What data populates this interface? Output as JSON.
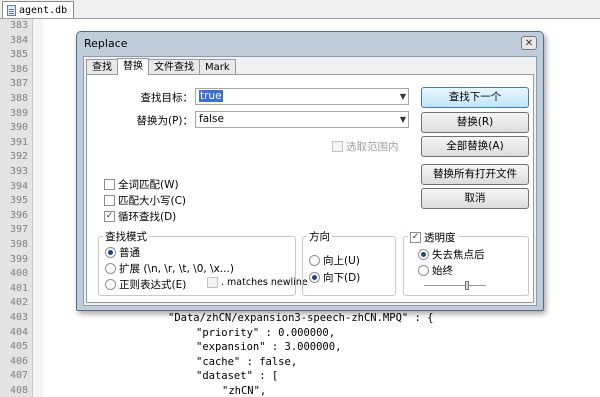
{
  "editor": {
    "tab_label": "agent.db",
    "line_numbers": [
      "383",
      "384",
      "385",
      "386",
      "387",
      "388",
      "389",
      "390",
      "391",
      "392",
      "393",
      "394",
      "395",
      "396",
      "397",
      "398",
      "399",
      "400",
      "401",
      "402",
      "403",
      "404",
      "405",
      "406",
      "407",
      "408"
    ],
    "code_lines": [
      {
        "line": "384",
        "text": "]"
      },
      {
        "line": "403",
        "text": "\"Data/zhCN/expansion3-speech-zhCN.MPQ\" : {"
      },
      {
        "line": "404",
        "text": "\"priority\" : 0.000000,"
      },
      {
        "line": "405",
        "text": "\"expansion\" : 3.000000,"
      },
      {
        "line": "406",
        "text": "\"cache\" : false,"
      },
      {
        "line": "407",
        "text": "\"dataset\" : ["
      },
      {
        "line": "408",
        "text": "\"zhCN\","
      }
    ]
  },
  "dialog": {
    "title": "Replace",
    "close_glyph": "✕",
    "tabs": [
      {
        "label": "查找",
        "active": false
      },
      {
        "label": "替换",
        "active": true
      },
      {
        "label": "文件查找",
        "active": false
      },
      {
        "label": "Mark",
        "active": false
      }
    ],
    "find_label": "查找目标：",
    "find_value": "true",
    "replace_label": "替换为(P)：",
    "replace_value": "false",
    "in_selection": "选取范围内",
    "buttons": {
      "find_next": "查找下一个",
      "replace": "替换(R)",
      "replace_all": "全部替换(A)",
      "replace_all_open": "替换所有打开文件",
      "cancel": "取消"
    },
    "options": {
      "whole_word": {
        "label": "全词匹配(W)",
        "checked": false
      },
      "match_case": {
        "label": "匹配大小写(C)",
        "checked": false
      },
      "wrap_around": {
        "label": "循环查找(D)",
        "checked": true
      }
    },
    "search_mode": {
      "title": "查找模式",
      "normal": "普通",
      "extended": "扩展 (\\n, \\r, \\t, \\0, \\x...)",
      "regex": "正则表达式(E)",
      "matches_newline": ". matches newline",
      "selected": "normal"
    },
    "direction": {
      "title": "方向",
      "up": "向上(U)",
      "down": "向下(D)",
      "selected": "down"
    },
    "transparency": {
      "title": "透明度",
      "enabled": true,
      "on_lose_focus": "失去焦点后",
      "always": "始终",
      "selected": "on_lose_focus",
      "level": 0.7
    }
  }
}
